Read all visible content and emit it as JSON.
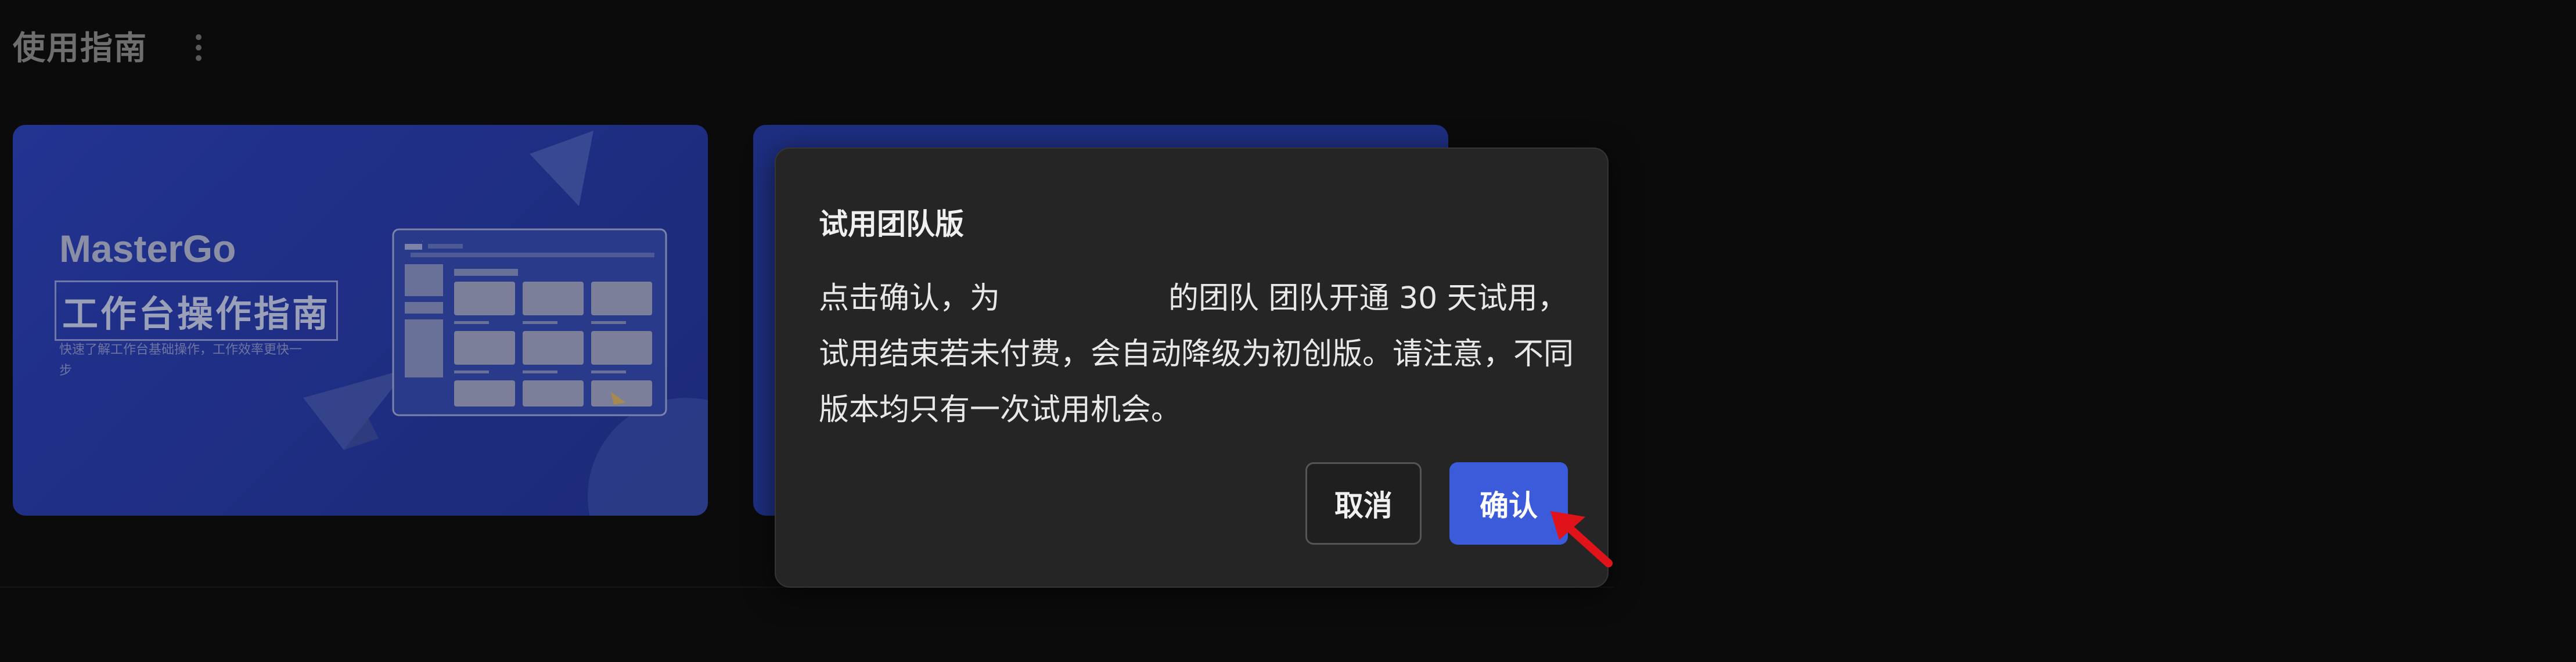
{
  "header": {
    "title": "使用指南",
    "more_icon": "more-vertical-icon"
  },
  "cards": [
    {
      "title_en": "MasterGo",
      "title_cn": "工作台操作指南",
      "subtitle": "快速了解工作台基础操作，工作效率更快一步"
    }
  ],
  "dialog": {
    "title": "试用团队版",
    "body_part1": "点击确认，为",
    "body_part2": "的团队 团队开通 30 天试用，试用结束若未付费，会自动降级为初创版。请注意，不同版本均只有一次试用机会。",
    "cancel_label": "取消",
    "confirm_label": "确认"
  },
  "colors": {
    "accent": "#3b5bdb",
    "card_blue": "#1e2f82",
    "dialog_bg": "#252525",
    "pointer": "#e0131b"
  }
}
